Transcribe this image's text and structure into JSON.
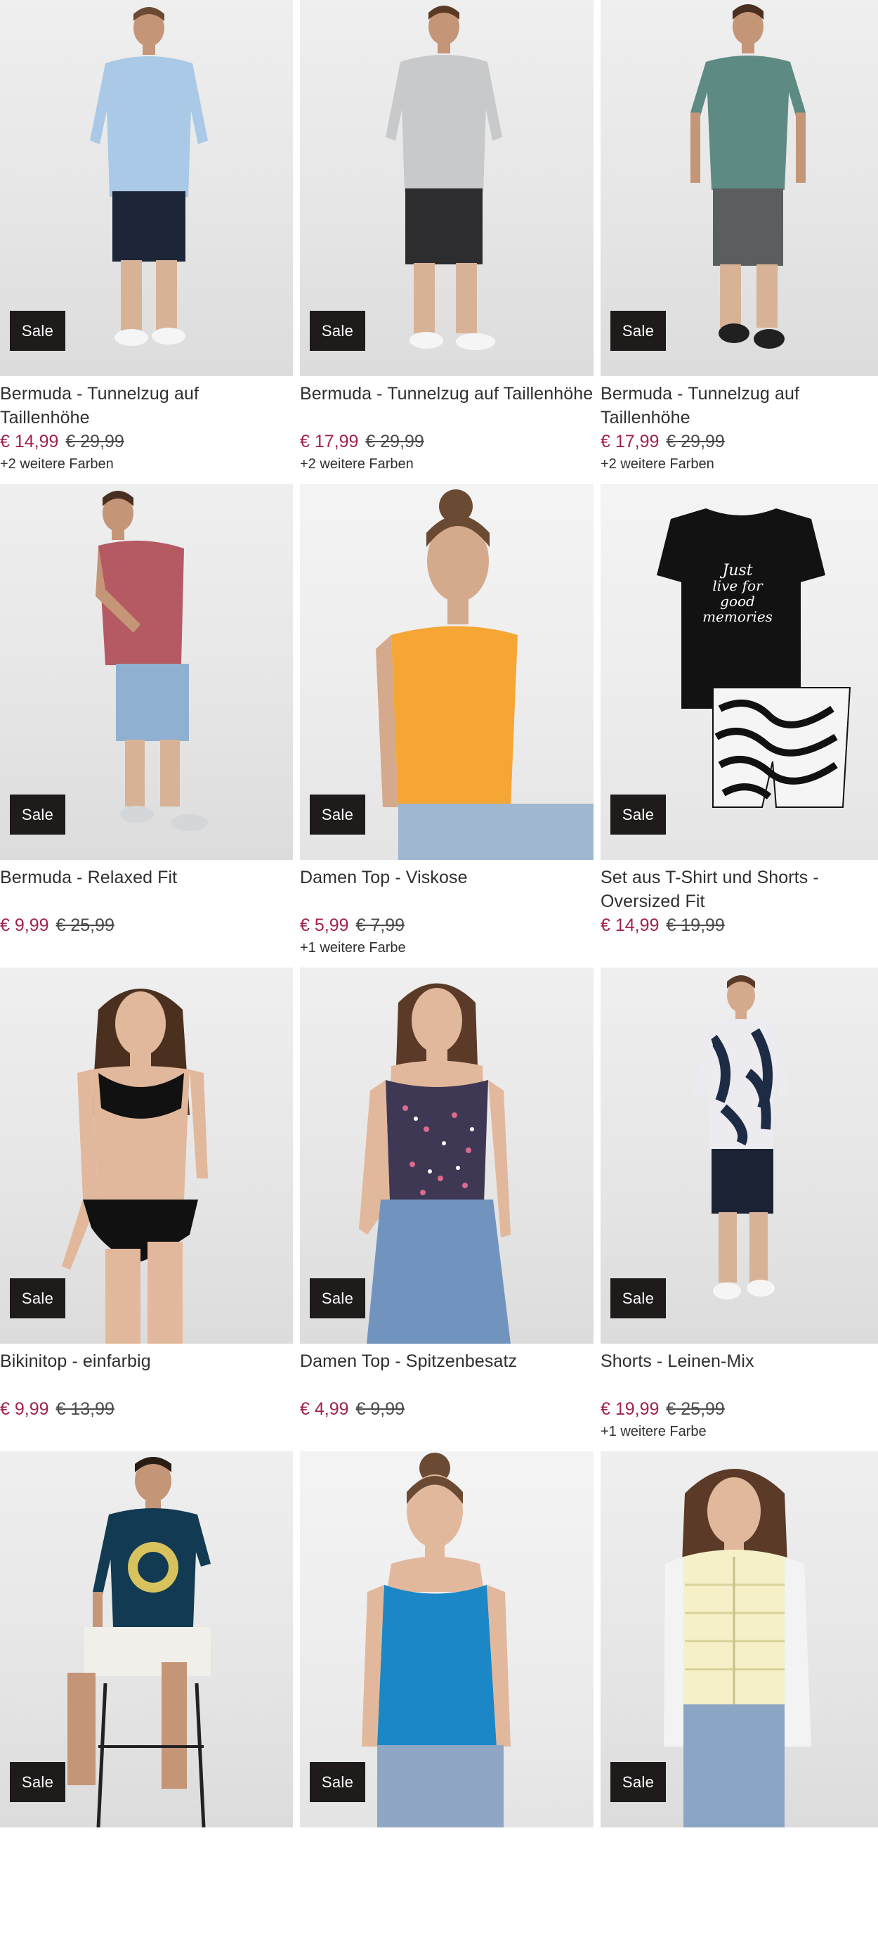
{
  "sale_label": "Sale",
  "colors": {
    "price_current": "#a0224c",
    "price_old": "#4a4a4a",
    "badge_bg": "#1f1b1b",
    "title_text": "#2f2f2f"
  },
  "products": [
    {
      "title": "Bermuda - Tunnelzug auf Taillenhöhe",
      "price_now": "€ 14,99",
      "price_old": "€ 29,99",
      "colors_note": "+2 weitere Farben",
      "image": "man-light-blue-shirt-navy-cargo-shorts"
    },
    {
      "title": "Bermuda - Tunnelzug auf Taillenhöhe",
      "price_now": "€ 17,99",
      "price_old": "€ 29,99",
      "colors_note": "+2 weitere Farben",
      "image": "man-grey-shirt-black-cargo-shorts"
    },
    {
      "title": "Bermuda - Tunnelzug auf Taillenhöhe",
      "price_now": "€ 17,99",
      "price_old": "€ 29,99",
      "colors_note": "+2 weitere Farben",
      "image": "man-leaf-print-tee-grey-cargo-shorts"
    },
    {
      "title": "Bermuda - Relaxed Fit",
      "price_now": "€ 9,99",
      "price_old": "€ 25,99",
      "colors_note": "",
      "image": "man-red-tee-denim-shorts"
    },
    {
      "title": "Damen Top - Viskose",
      "price_now": "€ 5,99",
      "price_old": "€ 7,99",
      "colors_note": "+1 weitere Farbe",
      "image": "woman-orange-tank-top"
    },
    {
      "title": "Set aus T-Shirt und Shorts - Oversized Fit",
      "price_now": "€ 14,99",
      "price_old": "€ 19,99",
      "colors_note": "",
      "image": "black-tee-and-zebra-shorts-flatlay"
    },
    {
      "title": "Bikinitop - einfarbig",
      "price_now": "€ 9,99",
      "price_old": "€ 13,99",
      "colors_note": "",
      "image": "woman-black-bikini"
    },
    {
      "title": "Damen Top - Spitzenbesatz",
      "price_now": "€ 4,99",
      "price_old": "€ 9,99",
      "colors_note": "",
      "image": "woman-floral-lace-top"
    },
    {
      "title": "Shorts - Leinen-Mix",
      "price_now": "€ 19,99",
      "price_old": "€ 25,99",
      "colors_note": "+1 weitere Farbe",
      "image": "man-palm-print-shirt-navy-shorts"
    },
    {
      "title": "",
      "price_now": "",
      "price_old": "",
      "colors_note": "",
      "image": "man-navy-graphic-tee-seated"
    },
    {
      "title": "",
      "price_now": "",
      "price_old": "",
      "colors_note": "",
      "image": "woman-blue-cami-top"
    },
    {
      "title": "",
      "price_now": "",
      "price_old": "",
      "colors_note": "",
      "image": "woman-yellow-puffer-vest"
    }
  ]
}
